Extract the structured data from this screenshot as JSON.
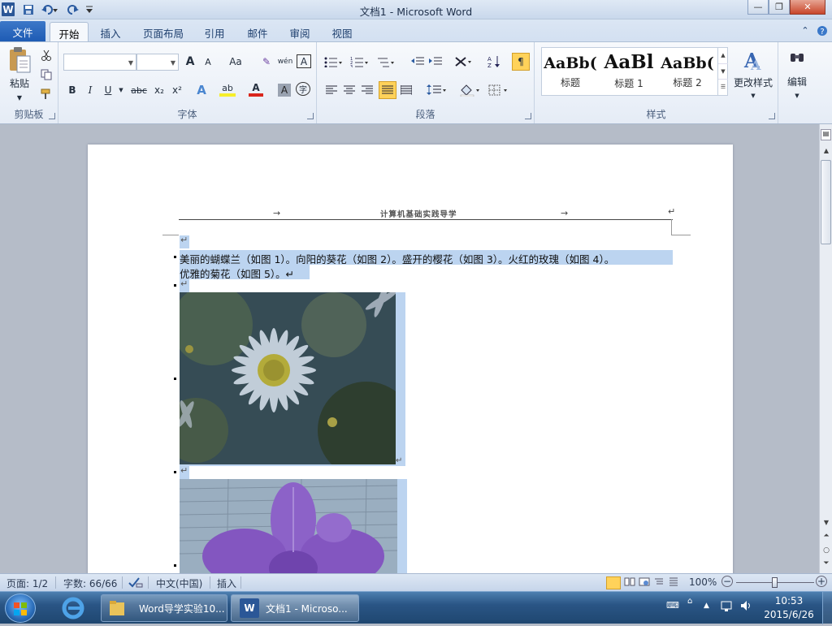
{
  "window": {
    "title": "文档1 - Microsoft Word"
  },
  "quick_access": {
    "app_icon": "W",
    "save_icon": "save-icon",
    "undo_icon": "undo-icon",
    "redo_icon": "redo-icon",
    "customize_icon": "customize-icon"
  },
  "window_controls": {
    "minimize": "—",
    "restore": "❐",
    "close": "✕"
  },
  "tabs": [
    {
      "label": "文件"
    },
    {
      "label": "开始"
    },
    {
      "label": "插入"
    },
    {
      "label": "页面布局"
    },
    {
      "label": "引用"
    },
    {
      "label": "邮件"
    },
    {
      "label": "审阅"
    },
    {
      "label": "视图"
    }
  ],
  "ribbon": {
    "clipboard": {
      "label": "剪贴板",
      "paste": "粘贴"
    },
    "font": {
      "label": "字体",
      "font_name": "",
      "font_size": "",
      "grow": "A",
      "shrink": "A",
      "case": "Aa",
      "clear": "✎",
      "phonetic": "wén",
      "border": "A",
      "bold": "B",
      "italic": "I",
      "underline": "U",
      "strike": "abc",
      "subscript": "x₂",
      "superscript": "x²",
      "effects": "A",
      "highlight": "ab",
      "color": "A",
      "shading": "A",
      "enclose": "字"
    },
    "paragraph": {
      "label": "段落"
    },
    "styles": {
      "label": "样式",
      "items": [
        {
          "sample": "AaBb(",
          "name": "标题"
        },
        {
          "sample": "AaBl",
          "name": "标题 1"
        },
        {
          "sample": "AaBb(",
          "name": "标题 2"
        }
      ],
      "change": "更改样式"
    },
    "editing": {
      "label": "编辑"
    }
  },
  "document": {
    "header": "计算机基础实践导学",
    "paragraph_line1": "美丽的蝴蝶兰（如图 1）。向阳的葵花（如图 2）。盛开的樱花（如图 3）。火红的玫瑰（如图 4）。",
    "paragraph_line2": "优雅的菊花（如图 5）。↵",
    "para_mark": "↵",
    "tab_arrow": "→"
  },
  "status": {
    "page": "页面: 1/2",
    "words": "字数: 66/66",
    "language": "中文(中国)",
    "mode": "插入",
    "zoom": "100%",
    "zoom_fraction": 0.5
  },
  "taskbar": {
    "items": [
      {
        "label": "Word导学实验10..."
      },
      {
        "label": "文档1 - Microso..."
      }
    ],
    "time": "10:53",
    "date": "2015/6/26"
  }
}
